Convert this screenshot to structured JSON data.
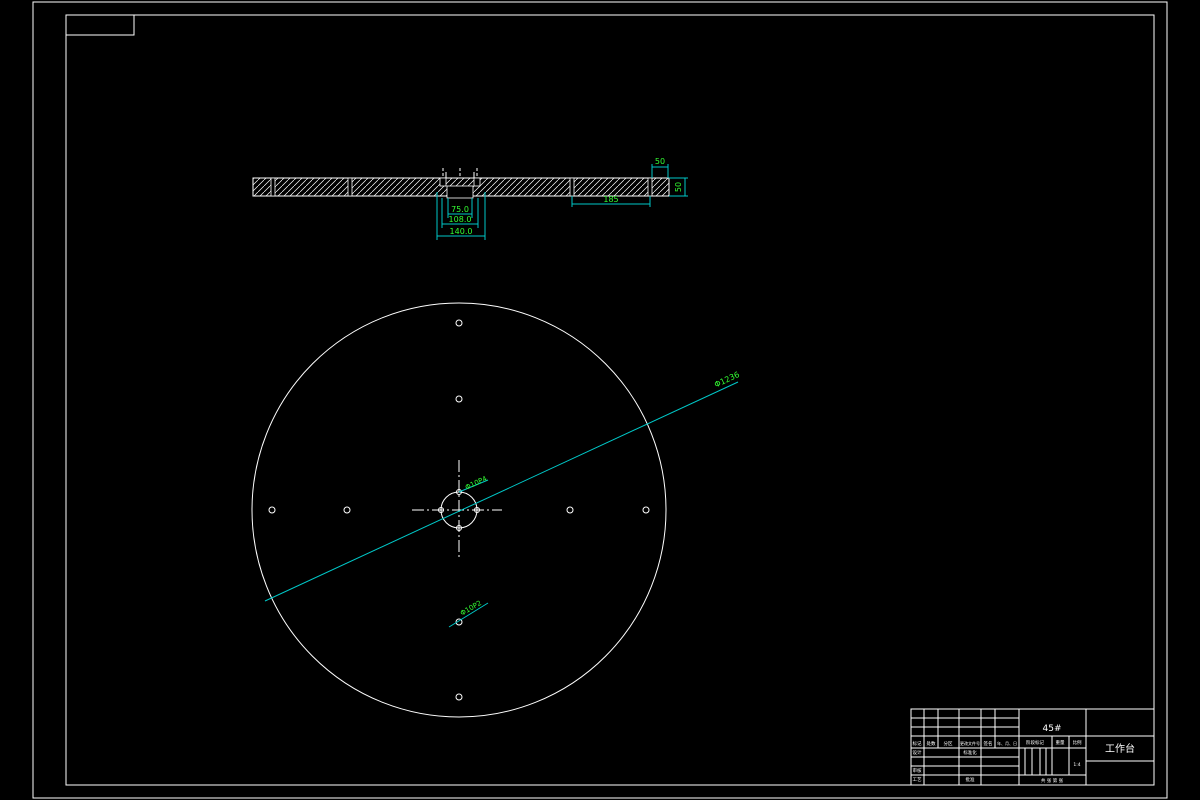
{
  "title_block": {
    "material": "45#",
    "part_name": "工作台",
    "row_labels_left": [
      "标记",
      "处数",
      "分区",
      "更改文件号",
      "签名",
      "年、月、日"
    ],
    "row_design": "设计",
    "row_standardization": "标准化",
    "row_review": "审核",
    "row_process": "工艺",
    "row_approve": "批准",
    "stage_label": "阶段标记",
    "weight_label": "重量",
    "scale_label": "比例",
    "scale_value": "1:4",
    "sheet_text": "共 张 第 张"
  },
  "dimensions": {
    "slot_width": "50",
    "plate_thickness": "50",
    "slot_spacing": "185",
    "bore_inner": "75.0",
    "bore_mid": "108.0",
    "bore_outer": "140.0",
    "diameter_outer": "Φ1236",
    "hole_center": "Φ10P4",
    "hole_small": "Φ10P2"
  },
  "colors": {
    "line": "#ffffff",
    "dimension_line": "#00c8c8",
    "dimension_text": "#33ff33",
    "background": "#000000"
  }
}
